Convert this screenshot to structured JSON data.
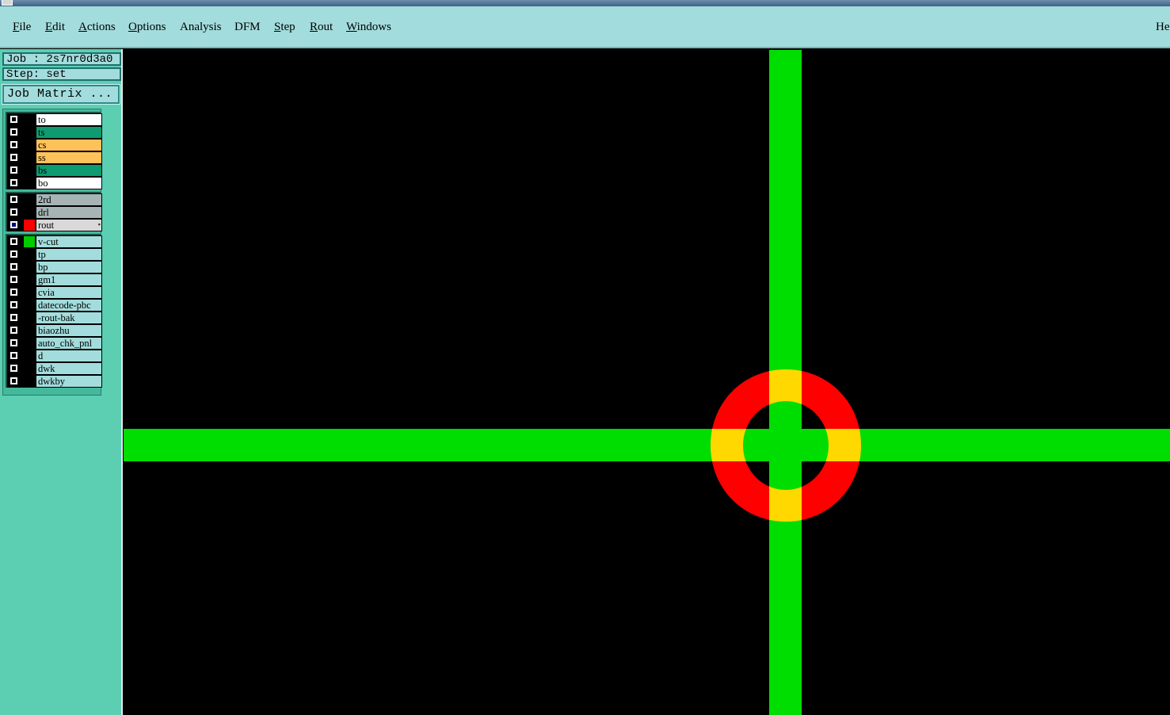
{
  "window": {
    "title": ""
  },
  "menu": {
    "items": [
      {
        "label": "File",
        "mnemonic": "F",
        "rest": "ile"
      },
      {
        "label": "Edit",
        "mnemonic": "E",
        "rest": "dit"
      },
      {
        "label": "Actions",
        "mnemonic": "A",
        "rest": "ctions"
      },
      {
        "label": "Options",
        "mnemonic": "O",
        "rest": "ptions"
      },
      {
        "label": "Analysis",
        "mnemonic": "",
        "rest": "Analysis"
      },
      {
        "label": "DFM",
        "mnemonic": "",
        "rest": "DFM"
      },
      {
        "label": "Step",
        "mnemonic": "S",
        "rest": "tep"
      },
      {
        "label": "Rout",
        "mnemonic": "R",
        "rest": "out"
      },
      {
        "label": "Windows",
        "mnemonic": "W",
        "rest": "indows"
      }
    ],
    "help_label": "He"
  },
  "panel": {
    "job_text": "Job : 2s7nr0d3a0",
    "step_text": "Step: set",
    "job_matrix_label": "Job Matrix ..."
  },
  "layers": {
    "board": [
      {
        "name": "to",
        "color": "#ffffff",
        "swatch": "#000000"
      },
      {
        "name": "ts",
        "color": "#0e9b70",
        "swatch": "#000000"
      },
      {
        "name": "cs",
        "color": "#ffc159",
        "swatch": "#000000"
      },
      {
        "name": "ss",
        "color": "#ffc159",
        "swatch": "#000000"
      },
      {
        "name": "bs",
        "color": "#0e9b70",
        "swatch": "#000000"
      },
      {
        "name": "bo",
        "color": "#ffffff",
        "swatch": "#000000"
      }
    ],
    "drill": [
      {
        "name": "2rd",
        "color": "#a6b4b6",
        "swatch": "#000000"
      },
      {
        "name": "drl",
        "color": "#a6b4b6",
        "swatch": "#000000"
      },
      {
        "name": "rout",
        "color": "#d9d9d9",
        "swatch": "#ff0000",
        "active": true,
        "marker": "▪"
      }
    ],
    "misc": [
      {
        "name": "v-cut",
        "color": "#a3dcdc",
        "swatch": "#00cc00"
      },
      {
        "name": "tp",
        "color": "#a3dcdc",
        "swatch": "#000000"
      },
      {
        "name": "bp",
        "color": "#a3dcdc",
        "swatch": "#000000"
      },
      {
        "name": "gm1",
        "color": "#a3dcdc",
        "swatch": "#000000"
      },
      {
        "name": "cvia",
        "color": "#a3dcdc",
        "swatch": "#000000"
      },
      {
        "name": "datecode-pbc",
        "color": "#a3dcdc",
        "swatch": "#000000"
      },
      {
        "name": "-rout-bak",
        "color": "#a3dcdc",
        "swatch": "#000000"
      },
      {
        "name": "biaozhu",
        "color": "#a3dcdc",
        "swatch": "#000000"
      },
      {
        "name": "auto_chk_pnl",
        "color": "#a3dcdc",
        "swatch": "#000000"
      },
      {
        "name": "d",
        "color": "#a3dcdc",
        "swatch": "#000000"
      },
      {
        "name": "dwk",
        "color": "#a3dcdc",
        "swatch": "#000000"
      },
      {
        "name": "dwkby",
        "color": "#a3dcdc",
        "swatch": "#000000"
      }
    ]
  },
  "canvas": {
    "background": "#000000",
    "vcut_color": "#00dd00",
    "rout_color": "#ff0000",
    "overlap_color": "#ffd800"
  }
}
